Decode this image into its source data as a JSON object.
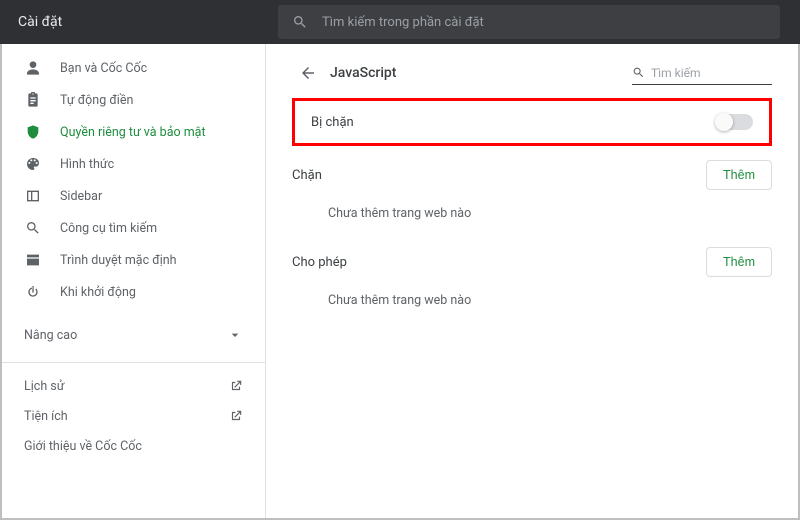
{
  "header": {
    "title": "Cài đặt",
    "search_placeholder": "Tìm kiếm trong phần cài đặt"
  },
  "sidebar": {
    "items": [
      {
        "label": "Bạn và Cốc Cốc"
      },
      {
        "label": "Tự động điền"
      },
      {
        "label": "Quyền riêng tư và bảo mật"
      },
      {
        "label": "Hình thức"
      },
      {
        "label": "Sidebar"
      },
      {
        "label": "Công cụ tìm kiếm"
      },
      {
        "label": "Trình duyệt mặc định"
      },
      {
        "label": "Khi khởi động"
      }
    ],
    "advanced_label": "Nâng cao",
    "links": [
      {
        "label": "Lịch sử"
      },
      {
        "label": "Tiện ích"
      },
      {
        "label": "Giới thiệu về Cốc Cốc"
      }
    ]
  },
  "page": {
    "title": "JavaScript",
    "search_label": "Tìm kiếm",
    "toggle_label": "Bị chặn",
    "sections": {
      "block": {
        "title": "Chặn",
        "add": "Thêm",
        "empty": "Chưa thêm trang web nào"
      },
      "allow": {
        "title": "Cho phép",
        "add": "Thêm",
        "empty": "Chưa thêm trang web nào"
      }
    }
  }
}
